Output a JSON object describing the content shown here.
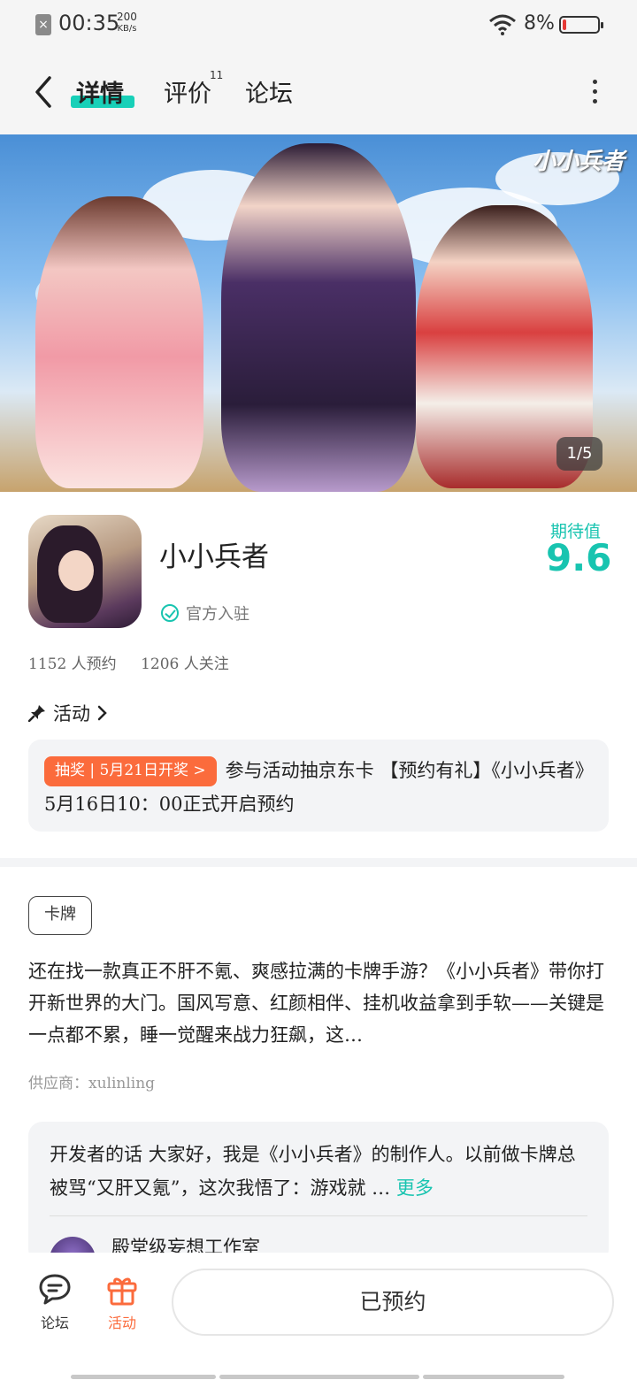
{
  "status_bar": {
    "time": "00:35",
    "net_speed_value": "200",
    "net_speed_unit": "KB/s",
    "battery_percent": "8%",
    "icons": [
      "sim-off-icon",
      "wifi-icon",
      "battery-low-icon"
    ]
  },
  "nav": {
    "tabs": [
      {
        "label": "详情",
        "active": true
      },
      {
        "label": "评价",
        "count": "11"
      },
      {
        "label": "论坛"
      }
    ]
  },
  "banner": {
    "logo_text": "小小兵者",
    "counter": "1/5"
  },
  "app": {
    "name": "小小兵者",
    "verified_label": "官方入驻",
    "expect_label": "期待值",
    "expect_score": "9.6",
    "reservations": "1152 人预约",
    "follows": "1206 人关注"
  },
  "activity": {
    "heading": "活动",
    "badge": "抽奖 | 5月21日开奖 >",
    "text": "参与活动抽京东卡 【预约有礼】《小小兵者》5月16日10：00正式开启预约"
  },
  "tag": "卡牌",
  "description": "还在找一款真正不肝不氪、爽感拉满的卡牌手游？《小小兵者》带你打开新世界的大门。国风写意、红颜相伴、挂机收益拿到手软——关键是一点都不累，睡一觉醒来战力狂飙，这…",
  "supplier": "供应商：xulinling",
  "developer": {
    "text": "开发者的话  大家好，我是《小小兵者》的制作人。以前做卡牌总被骂“又肝又氪”，这次我悟了：游戏就 …",
    "more_label": "更多",
    "studio": "殿堂级妄想工作室"
  },
  "bottom_bar": {
    "forum_label": "论坛",
    "activity_label": "活动",
    "reserve_label": "已预约"
  },
  "colors": {
    "accent": "#18c4b0",
    "orange": "#fb6b3c"
  }
}
